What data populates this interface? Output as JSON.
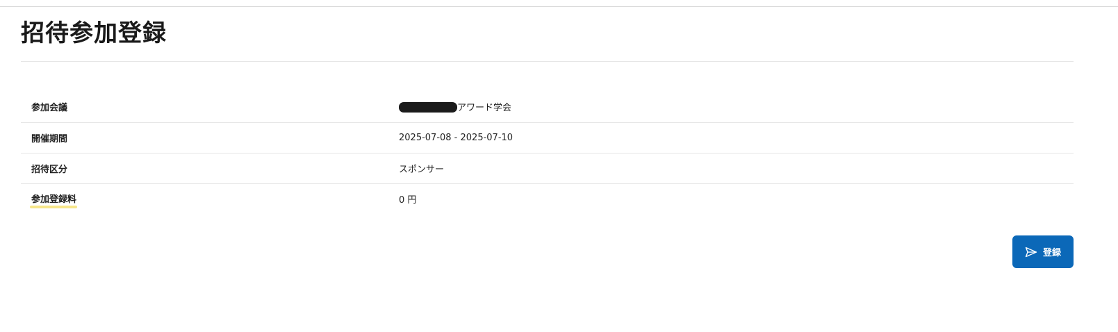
{
  "page": {
    "title": "招待参加登録"
  },
  "details": {
    "rows": [
      {
        "label": "参加会議",
        "value": "アワード学会",
        "redacted_prefix": true
      },
      {
        "label": "開催期間",
        "value": "2025-07-08 - 2025-07-10"
      },
      {
        "label": "招待区分",
        "value": "スポンサー"
      },
      {
        "label": "参加登録料",
        "value": "0 円",
        "highlighted": true
      }
    ]
  },
  "actions": {
    "submit_label": "登録",
    "submit_icon": "send-icon",
    "submit_color": "#0b68b8"
  },
  "colors": {
    "highlight": "#f7e68a",
    "divider": "#e6e6e6"
  }
}
